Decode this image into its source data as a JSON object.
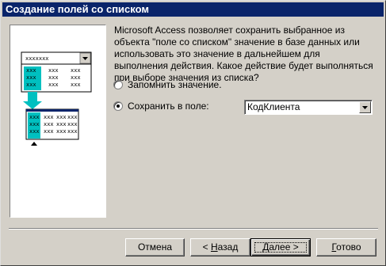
{
  "window": {
    "title": "Создание полей со списком"
  },
  "illustration": {
    "combo_text": "xxxxxxx",
    "cell_text": "xxx"
  },
  "description": "Microsoft Access позволяет сохранить выбранное из объекта \"поле со списком\" значение в базе данных или использовать это значение в дальнейшем для выполнения действия.  Какое действие будет выполняться при выборе значения из списка?",
  "options": {
    "remember": {
      "label": "Запомнить значение.",
      "selected": false
    },
    "store": {
      "label": "Сохранить в поле:",
      "selected": true
    }
  },
  "field_combo": {
    "value": "КодКлиента"
  },
  "buttons": {
    "cancel": "Отмена",
    "back_prefix": "< ",
    "back_u": "Н",
    "back_rest": "азад",
    "next_u": "Д",
    "next_rest": "алее >",
    "finish_u": "Г",
    "finish_rest": "отово"
  },
  "colors": {
    "title_bar": "#0a246a",
    "highlight": "#00c0c0",
    "face": "#d4d0c8"
  }
}
